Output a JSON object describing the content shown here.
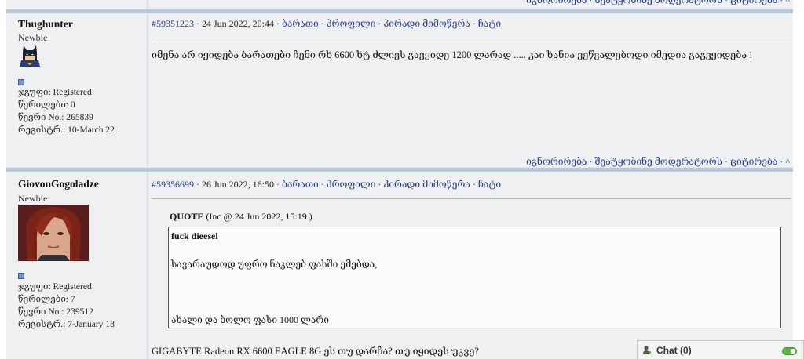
{
  "post_actions": {
    "ignore": "იგნორირება",
    "report": "შეატყობინე მოდერატორს",
    "quote": "ციტირება",
    "up": "^",
    "separator": " · "
  },
  "posts": [
    {
      "username": "Thughunter",
      "rank": "Newbie",
      "avatar": "batman-avatar",
      "group": "ჯგუფი: Registered",
      "posts_count": "წერილები: 0",
      "member_no": "წევრი No.: 265839",
      "registered": "რეგისტრ.: 10-March 22",
      "post_id": "#59351223",
      "date": "24 Jun 2022, 20:44",
      "links": [
        "ბარათი",
        "პროფილი",
        "პირადი მიმოწერა",
        "ჩატი"
      ],
      "text": "იმენა არ იყიდება ბარათები ჩემი რხ 6600 ხტ ძლივს გავყიდე 1200 ლარად ..... კაი ხანია ვეწვალებოდი იმედია გაგვყიდება !"
    },
    {
      "username": "GiovonGogoladze",
      "rank": "Newbie",
      "avatar": "woman-avatar",
      "group": "ჯგუფი: Registered",
      "posts_count": "წერილები: 7",
      "member_no": "წევრი No.: 239512",
      "registered": "რეგისტრ.: 7-January 18",
      "post_id": "#59356699",
      "date": "26 Jun 2022, 16:50",
      "links": [
        "ბარათი",
        "პროფილი",
        "პირადი მიმოწერა",
        "ჩატი"
      ],
      "quote": {
        "label": "QUOTE",
        "source": "(Inc @ 24 Jun 2022, 15:19 )",
        "line1": "fuck dieesel",
        "line2": "სავარაუდოდ უფრო ნაკლებ ფასში ემებდა,",
        "line3": "ახალი და ბოლო ფასი 1000 ლარი"
      },
      "text": "GIGABYTE Radeon RX 6600 EAGLE 8G ეს თუ დარჩა? თუ იყიდეს უკვე?"
    }
  ],
  "chat": {
    "label": "Chat",
    "count": "(0)",
    "icon": "user-online-icon",
    "status_color": "#5fb548"
  }
}
